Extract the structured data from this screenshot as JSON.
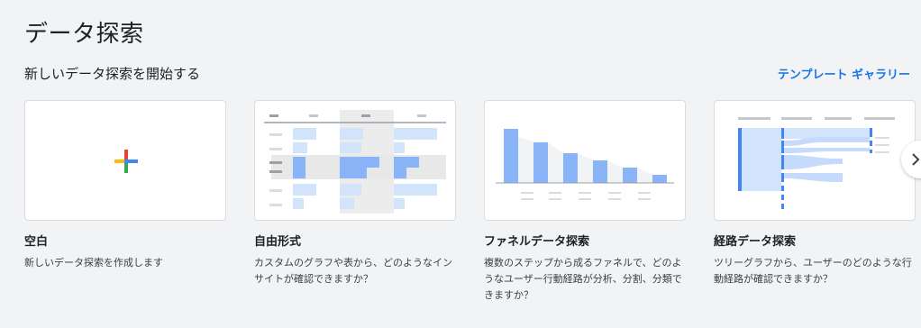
{
  "page": {
    "title": "データ探索",
    "section_title": "新しいデータ探索を開始する",
    "gallery_link": "テンプレート ギャラリー"
  },
  "cards": [
    {
      "title": "空白",
      "description": "新しいデータ探索を作成します",
      "thumbnail": "plus-icon"
    },
    {
      "title": "自由形式",
      "description": "カスタムのグラフや表から、どのようなインサイトが確認できますか？",
      "thumbnail": "table-preview"
    },
    {
      "title": "ファネルデータ探索",
      "description": "複数のステップから成るファネルで、どのようなユーザー行動経路が分析、分割、分類できますか？",
      "thumbnail": "funnel-preview"
    },
    {
      "title": "経路データ探索",
      "description": "ツリーグラフから、ユーザーのどのような行動経路が確認できますか？",
      "thumbnail": "path-preview"
    }
  ],
  "colors": {
    "accent": "#1a73e8",
    "plus_red": "#ea4335",
    "plus_blue": "#4285f4",
    "plus_yellow": "#fbbc04",
    "plus_green": "#34a853",
    "preview_blue": "#8ab4f8",
    "preview_light_blue": "#d2e3fc",
    "preview_gray": "#dadce0"
  },
  "icons": {
    "next": "chevron-right-icon"
  }
}
